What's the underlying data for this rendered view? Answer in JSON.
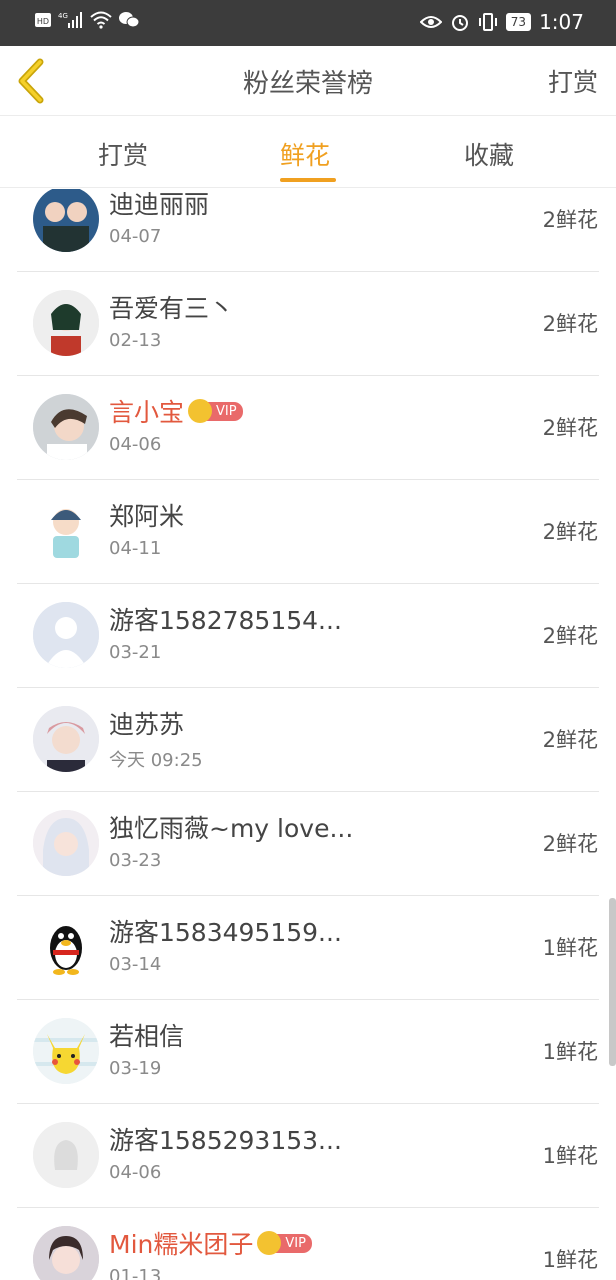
{
  "status_bar": {
    "left_icons": [
      "hd-icon",
      "signal-4g-icon",
      "wifi-icon",
      "wechat-icon"
    ],
    "battery": "73",
    "time": "1:07"
  },
  "header": {
    "title": "粉丝荣誉榜",
    "action": "打赏"
  },
  "tabs": [
    {
      "label": "打赏",
      "active": false
    },
    {
      "label": "鲜花",
      "active": true
    },
    {
      "label": "收藏",
      "active": false
    }
  ],
  "accent_color": "#f0a020",
  "vip_badge_text": "VIP",
  "list": [
    {
      "name": "迪迪丽丽",
      "date": "04-07",
      "count": "2鲜花",
      "vip": false
    },
    {
      "name": "吾爱有三丶",
      "date": "02-13",
      "count": "2鲜花",
      "vip": false
    },
    {
      "name": "言小宝",
      "date": "04-06",
      "count": "2鲜花",
      "vip": true
    },
    {
      "name": "郑阿米",
      "date": "04-11",
      "count": "2鲜花",
      "vip": false
    },
    {
      "name": "游客1582785154...",
      "date": "03-21",
      "count": "2鲜花",
      "vip": false
    },
    {
      "name": "迪苏苏",
      "date": "今天 09:25",
      "count": "2鲜花",
      "vip": false
    },
    {
      "name": "独忆雨薇~my love...",
      "date": "03-23",
      "count": "2鲜花",
      "vip": false
    },
    {
      "name": "游客1583495159...",
      "date": "03-14",
      "count": "1鲜花",
      "vip": false
    },
    {
      "name": "若相信",
      "date": "03-19",
      "count": "1鲜花",
      "vip": false
    },
    {
      "name": "游客1585293153...",
      "date": "04-06",
      "count": "1鲜花",
      "vip": false
    },
    {
      "name": "Min糯米团子",
      "date": "01-13",
      "count": "1鲜花",
      "vip": true
    }
  ]
}
